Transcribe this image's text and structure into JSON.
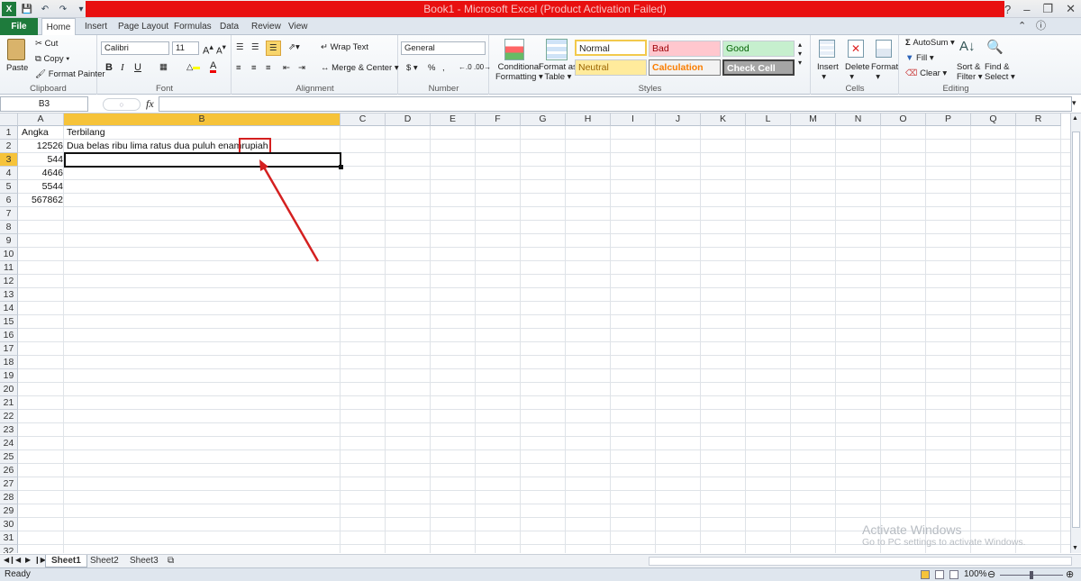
{
  "window": {
    "title": "Book1 - Microsoft Excel (Product Activation Failed)"
  },
  "ribbon_tabs": [
    "File",
    "Home",
    "Insert",
    "Page Layout",
    "Formulas",
    "Data",
    "Review",
    "View"
  ],
  "clipboard": {
    "paste": "Paste",
    "cut": "Cut",
    "copy": "Copy",
    "format_painter": "Format Painter",
    "label": "Clipboard"
  },
  "font": {
    "name": "Calibri",
    "size": "11",
    "label": "Font"
  },
  "alignment": {
    "wrap": "Wrap Text",
    "merge": "Merge & Center",
    "label": "Alignment"
  },
  "number": {
    "format": "General",
    "label": "Number"
  },
  "styles": {
    "conditional": [
      "Conditional",
      "Formatting"
    ],
    "format_as_table": [
      "Format as",
      "Table"
    ],
    "cells": [
      "Normal",
      "Bad",
      "Good",
      "Neutral",
      "Calculation",
      "Check Cell"
    ],
    "label": "Styles",
    "colors": {
      "normal_bg": "#ffffff",
      "bad_bg": "#ffc7ce",
      "bad_fg": "#9c0006",
      "good_bg": "#c6efce",
      "good_fg": "#006100",
      "neutral_bg": "#ffeb9c",
      "neutral_fg": "#9c6500",
      "calc_bg": "#f2f2f2",
      "calc_fg": "#fa7d00",
      "check_bg": "#a5a5a5",
      "check_fg": "#ffffff"
    }
  },
  "cells_group": {
    "insert": "Insert",
    "delete": "Delete",
    "format": "Format",
    "label": "Cells"
  },
  "editing": {
    "autosum": "AutoSum",
    "fill": "Fill",
    "clear": "Clear",
    "sort_filter": [
      "Sort &",
      "Filter"
    ],
    "find_select": [
      "Find &",
      "Select"
    ],
    "label": "Editing"
  },
  "formula_bar": {
    "name_box": "B3",
    "fx": "fx",
    "content": ""
  },
  "columns": [
    "A",
    "B",
    "C",
    "D",
    "E",
    "F",
    "G",
    "H",
    "I",
    "J",
    "K",
    "L",
    "M",
    "N",
    "O",
    "P",
    "Q",
    "R"
  ],
  "rows": [
    "1",
    "2",
    "3",
    "4",
    "5",
    "6",
    "7",
    "8",
    "9",
    "10",
    "11",
    "12",
    "13",
    "14",
    "15",
    "16",
    "17",
    "18",
    "19",
    "20",
    "21",
    "22",
    "23",
    "24",
    "25",
    "26",
    "27",
    "28",
    "29",
    "30",
    "31",
    "32"
  ],
  "data": {
    "A1": "Angka",
    "B1": "Terbilang",
    "A2": "12526",
    "B2": "Dua belas ribu lima ratus dua puluh enam",
    "B2_highlight": "rupiah",
    "A3": "544",
    "A4": "4646",
    "A5": "5544",
    "A6": "567862"
  },
  "sheets": [
    "Sheet1",
    "Sheet2",
    "Sheet3"
  ],
  "status": {
    "ready": "Ready",
    "zoom": "100%"
  },
  "watermark": {
    "line1": "Activate Windows",
    "line2": "Go to PC settings to activate Windows."
  },
  "accent": {
    "title_red": "#e81010",
    "file_green": "#1e7b3c",
    "selection_orange": "#f6c33a",
    "annotation_red": "#d42020"
  }
}
